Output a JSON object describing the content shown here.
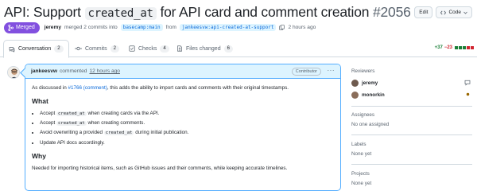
{
  "pr": {
    "title_prefix": "API: Support",
    "title_code": "created_at",
    "title_suffix": "for API card and comment creation",
    "number": "#2056",
    "state": "Merged",
    "author": "jeremy",
    "merged_text": "merged 2 commits into",
    "base_branch": "basecamp:main",
    "from_text": "from",
    "head_branch": "jankeesvw:api-created-at-support",
    "time": "2 hours ago"
  },
  "header_buttons": {
    "edit": "Edit",
    "code": "Code"
  },
  "tabs": [
    {
      "label": "Conversation",
      "count": "2",
      "icon": "conversation-icon"
    },
    {
      "label": "Commits",
      "count": "2",
      "icon": "commit-icon"
    },
    {
      "label": "Checks",
      "count": "4",
      "icon": "checks-icon"
    },
    {
      "label": "Files changed",
      "count": "6",
      "icon": "file-diff-icon"
    }
  ],
  "diffstat": {
    "additions": "+37",
    "deletions": "−23",
    "blocks": [
      "#1a7f37",
      "#1a7f37",
      "#1a7f37",
      "#d1242f",
      "#d1242f"
    ]
  },
  "comment": {
    "author": "jankeesvw",
    "action": "commented",
    "time": "12 hours ago",
    "role": "Contributor",
    "intro_before": "As discussed in",
    "intro_link": "#1766 (comment)",
    "intro_after": ", this adds the ability to import cards and comments with their original timestamps.",
    "what_heading": "What",
    "items": [
      {
        "before": "Accept",
        "code": "created_at",
        "after": "when creating cards via the API."
      },
      {
        "before": "Accept",
        "code": "created_at",
        "after": "when creating comments."
      },
      {
        "before": "Avoid overwriting a provided",
        "code": "created_at",
        "after": "during initial publication."
      },
      {
        "before": "Update API docs accordingly.",
        "code": "",
        "after": ""
      }
    ],
    "why_heading": "Why",
    "why_text": "Needed for importing historical items, such as GitHub issues and their comments, while keeping accurate timelines."
  },
  "sidebar": {
    "reviewers_heading": "Reviewers",
    "reviewers": [
      {
        "name": "jeremy",
        "status_icon": "comment-icon",
        "avatar_color": "#6e5a4e"
      },
      {
        "name": "monorkin",
        "status_icon": "pending-dot-icon",
        "avatar_color": "#8a6d5a"
      }
    ],
    "assignees_heading": "Assignees",
    "assignees_text": "No one assigned",
    "labels_heading": "Labels",
    "labels_text": "None yet",
    "projects_heading": "Projects",
    "projects_text": "None yet"
  },
  "colors": {
    "merged": "#8250df",
    "accent": "#0969da",
    "comment_border": "#54aeff",
    "comment_header": "#ddf4ff"
  }
}
